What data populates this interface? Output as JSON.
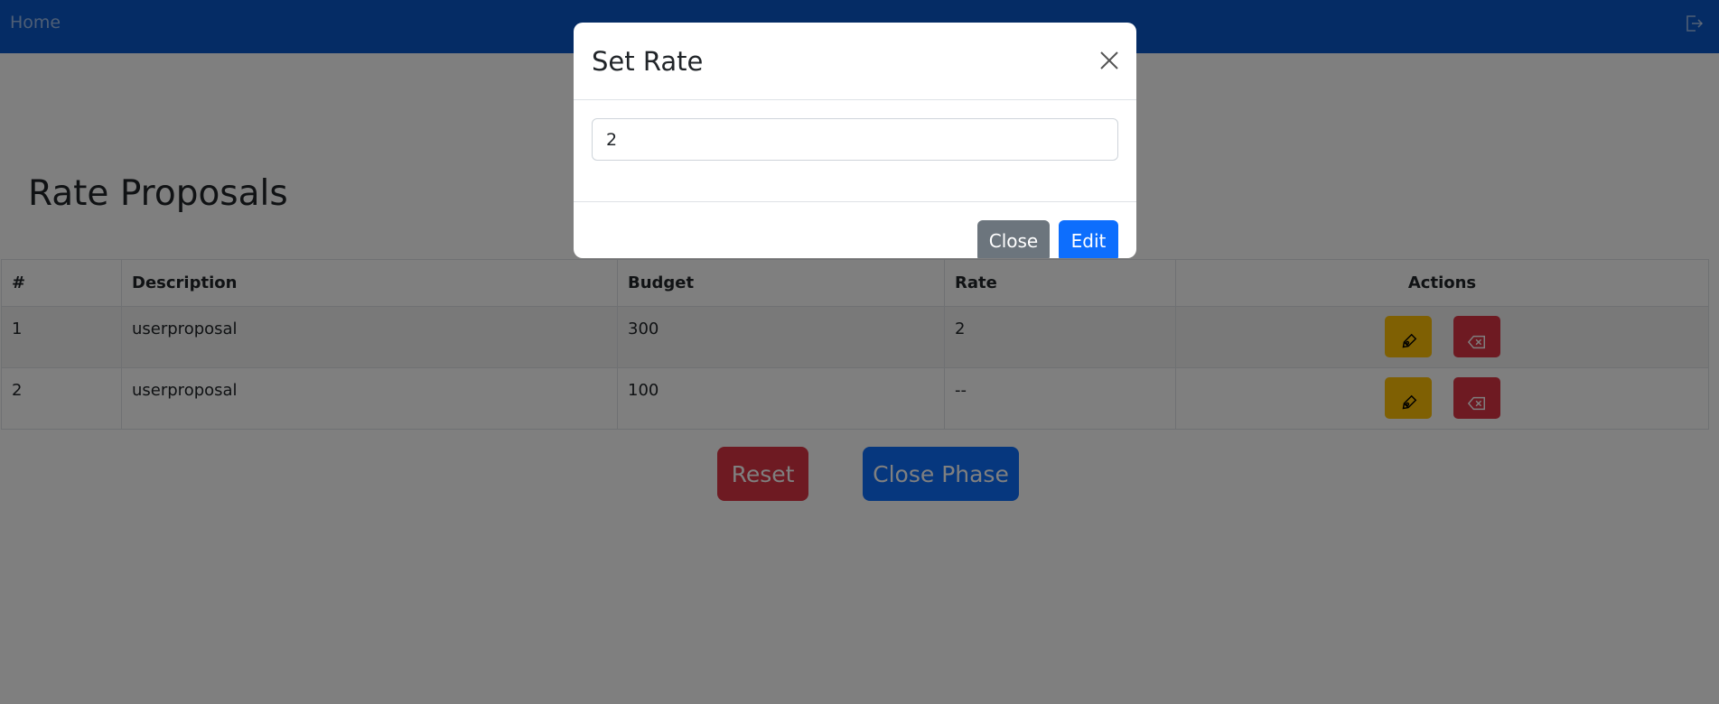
{
  "navbar": {
    "home_label": "Home",
    "logout_icon": "logout-icon",
    "background": "#0a58ca"
  },
  "page": {
    "title": "Rate Proposals"
  },
  "table": {
    "headers": [
      "#",
      "Description",
      "Budget",
      "Rate",
      "Actions"
    ],
    "rows": [
      {
        "id": "1",
        "description": "userproposal",
        "budget": "300",
        "rate": "2"
      },
      {
        "id": "2",
        "description": "userproposal",
        "budget": "100",
        "rate": "--"
      }
    ],
    "row_actions": [
      {
        "icon": "pen-icon",
        "color": "#ffc107"
      },
      {
        "icon": "backspace-x-icon",
        "color": "#dc3545"
      }
    ]
  },
  "actions": {
    "reset_label": "Reset",
    "close_phase_label": "Close Phase"
  },
  "modal": {
    "title": "Set Rate",
    "close_icon": "close-icon",
    "input_value": "2",
    "close_label": "Close",
    "edit_label": "Edit"
  },
  "colors": {
    "primary": "#0d6efd",
    "secondary": "#6c757d",
    "danger": "#dc3545",
    "warning": "#ffc107",
    "backdrop": "rgba(0,0,0,0.5)"
  }
}
